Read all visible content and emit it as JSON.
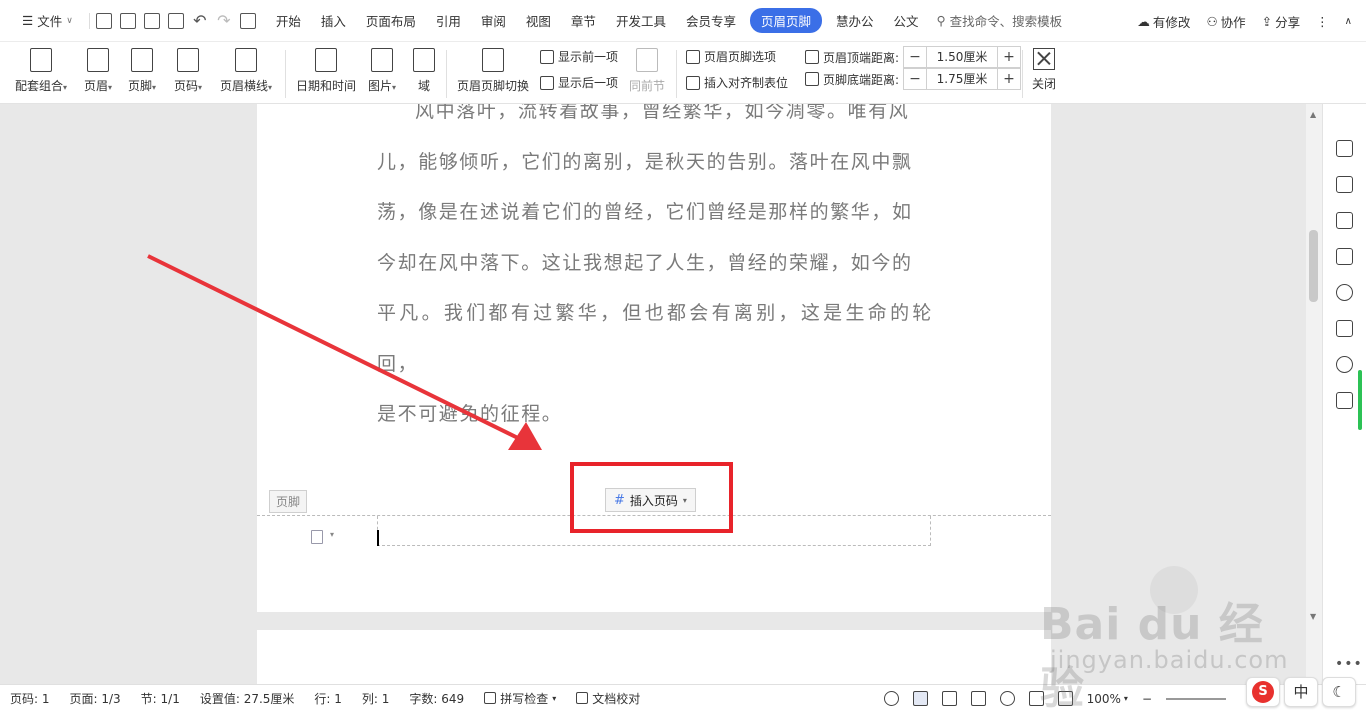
{
  "menubar": {
    "file": "文件",
    "tabs": [
      "开始",
      "插入",
      "页面布局",
      "引用",
      "审阅",
      "视图",
      "章节",
      "开发工具",
      "会员专享",
      "页眉页脚",
      "慧办公",
      "公文"
    ],
    "active_tab": "页眉页脚",
    "search_placeholder": "查找命令、搜索模板",
    "right": {
      "changes": "有修改",
      "collab": "协作",
      "share": "分享"
    }
  },
  "ribbon": {
    "buttons": [
      "配套组合",
      "页眉",
      "页脚",
      "页码",
      "页眉横线",
      "日期和时间",
      "图片",
      "域",
      "页眉页脚切换"
    ],
    "show_prev": "显示前一项",
    "show_next": "显示后一项",
    "same_as_prev": "同前节",
    "hf_options": "页眉页脚选项",
    "insert_align_tab": "插入对齐制表位",
    "header_top_label": "页眉顶端距离:",
    "header_top_value": "1.50厘米",
    "footer_bottom_label": "页脚底端距离:",
    "footer_bottom_value": "1.75厘米",
    "close": "关闭"
  },
  "document": {
    "lines": [
      "风中落叶，流转着故事，曾经繁华，如今凋零。唯有风",
      "儿，能够倾听，它们的离别，是秋天的告别。落叶在风中飘",
      "荡，像是在述说着它们的曾经，它们曾经是那样的繁华，如",
      "今却在风中落下。这让我想起了人生，曾经的荣耀，如今的",
      "平凡。我们都有过繁华，但也都会有离别，这是生命的轮回，",
      "是不可避免的征程。"
    ],
    "footer_tag": "页脚",
    "insert_page_number": "插入页码"
  },
  "statusbar": {
    "page": "页码: 1",
    "pages": "页面: 1/3",
    "section": "节: 1/1",
    "setting": "设置值: 27.5厘米",
    "row": "行: 1",
    "col": "列: 1",
    "words": "字数: 649",
    "spell": "拼写检查",
    "proof": "文档校对",
    "zoom": "100%"
  },
  "ime": {
    "lang": "中",
    "sogou": "S"
  },
  "watermark": {
    "main": "Bai du 经验",
    "sub": "jingyan.baidu.com"
  },
  "colors": {
    "accent": "#3b6fe7",
    "highlight": "#e8232a",
    "arrow": "#e8343a"
  }
}
